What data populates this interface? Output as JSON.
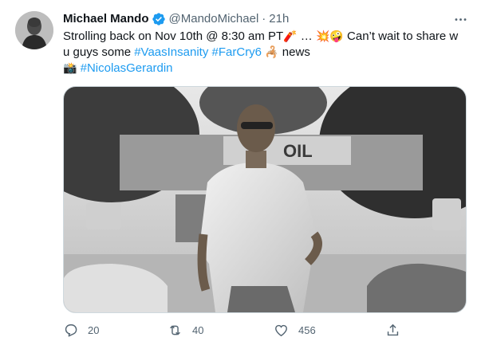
{
  "tweet": {
    "author": {
      "name": "Michael Mando",
      "handle": "@MandoMichael",
      "separator": "·",
      "time": "21h",
      "verified": true
    },
    "text": {
      "line1_part1": "Strolling back on Nov 10th @ 8:30 am PT",
      "line1_emoji1": "🧨",
      "line1_part2": " … ",
      "line1_emoji2": "💥",
      "line1_emoji3": "🤪",
      "line1_part3": " Can’t wait to share w",
      "line2_part1": "u guys some ",
      "hashtag_vaas": "#VaasInsanity",
      "hashtag_farcry": "#FarCry6",
      "line2_emoji": "🦂",
      "line2_part2": " news",
      "line3_emoji": "📸",
      "hashtag_photographer": "#NicolasGerardin"
    },
    "media": {
      "type": "photo",
      "storefront_sign": "OIL"
    },
    "actions": {
      "reply_count": "20",
      "retweet_count": "40",
      "like_count": "456"
    },
    "colors": {
      "link": "#1d9bf0",
      "secondary_text": "#536471",
      "verified": "#1d9bf0"
    }
  }
}
